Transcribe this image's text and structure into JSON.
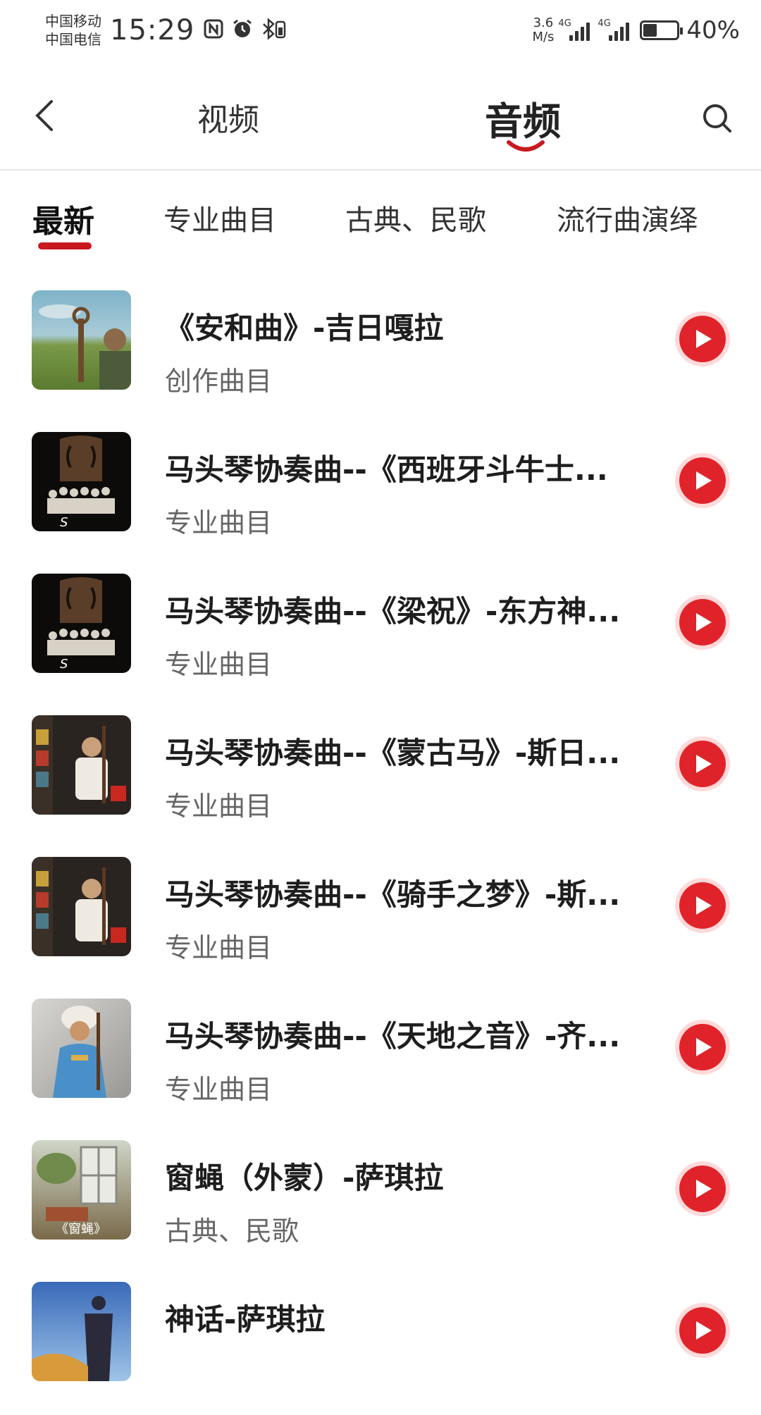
{
  "status_bar": {
    "carrier1": "中国移动",
    "carrier2": "中国电信",
    "time": "15:29",
    "speed_value": "3.6",
    "speed_unit": "M/s",
    "net1": "4G",
    "net2": "4G",
    "battery_percent": "40%",
    "battery_level": 0.4,
    "icons": [
      "nfc-icon",
      "alarm-icon",
      "bluetooth-battery-icon"
    ]
  },
  "top_nav": {
    "tabs": [
      {
        "label": "视频",
        "active": false
      },
      {
        "label": "音频",
        "active": true
      }
    ],
    "accent": "#c8191f"
  },
  "sub_tabs": [
    {
      "label": "最新",
      "active": true
    },
    {
      "label": "专业曲目",
      "active": false
    },
    {
      "label": "古典、民歌",
      "active": false
    },
    {
      "label": "流行曲演绎",
      "active": false
    }
  ],
  "tracks": [
    {
      "title": "《安和曲》-吉日嘎拉",
      "category": "创作曲目",
      "thumb": "grassland-musician"
    },
    {
      "title": "马头琴协奏曲--《西班牙斗牛士...",
      "category": "专业曲目",
      "thumb": "orchestra-dark"
    },
    {
      "title": "马头琴协奏曲--《梁祝》-东方神...",
      "category": "专业曲目",
      "thumb": "orchestra-dark"
    },
    {
      "title": "马头琴协奏曲--《蒙古马》-斯日...",
      "category": "专业曲目",
      "thumb": "album-poster"
    },
    {
      "title": "马头琴协奏曲--《骑手之梦》-斯...",
      "category": "专业曲目",
      "thumb": "album-poster"
    },
    {
      "title": "马头琴协奏曲--《天地之音》-齐...",
      "category": "专业曲目",
      "thumb": "costume-portrait"
    },
    {
      "title": "窗蝇（外蒙）-萨琪拉",
      "category": "古典、民歌",
      "thumb": "window-painting",
      "thumb_caption": "《窗蝇》"
    },
    {
      "title": "神话-萨琪拉",
      "category": "",
      "thumb": "sky-silhouette"
    }
  ],
  "colors": {
    "play_red": "#e0232a",
    "play_ring": "#ffd9d9"
  }
}
